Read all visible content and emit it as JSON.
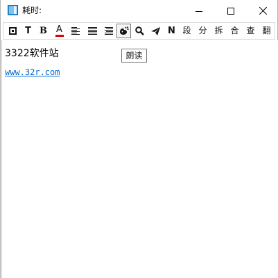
{
  "window": {
    "title": "耗时:"
  },
  "toolbar": {
    "buttons": [
      {
        "name": "border-box-icon"
      },
      {
        "name": "text-t-icon",
        "label": "T"
      },
      {
        "name": "bold-icon",
        "label": "B"
      },
      {
        "name": "font-color-icon",
        "label": "A"
      },
      {
        "name": "align-left-icon"
      },
      {
        "name": "align-center-icon"
      },
      {
        "name": "align-justify-icon"
      },
      {
        "name": "read-aloud-icon"
      },
      {
        "name": "search-icon"
      },
      {
        "name": "send-icon"
      },
      {
        "name": "n-icon",
        "label": "N"
      },
      {
        "name": "paragraph-button",
        "label": "段"
      },
      {
        "name": "split-button",
        "label": "分"
      },
      {
        "name": "dismantle-button",
        "label": "拆"
      },
      {
        "name": "merge-button",
        "label": "合"
      },
      {
        "name": "lookup-button",
        "label": "查"
      },
      {
        "name": "translate-button",
        "label": "翻"
      }
    ]
  },
  "content": {
    "line1": "3322软件站",
    "line2": "www.32r.com"
  },
  "tooltip": {
    "text": "朗读"
  },
  "colors": {
    "link": "#0066cc",
    "font_color_bar": "#e00000",
    "app_icon": "#2d8fd5"
  }
}
